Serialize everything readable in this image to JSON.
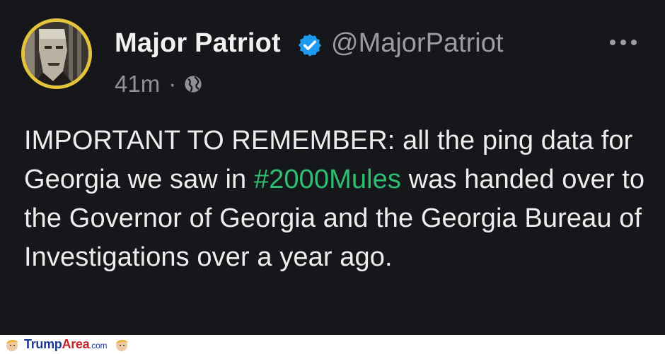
{
  "post": {
    "author_name": "Major Patriot",
    "author_handle": "@MajorPatriot",
    "time_ago": "41m",
    "separator": "·",
    "text_before": "IMPORTANT TO REMEMBER: all the ping data for Georgia we saw in ",
    "hashtag": "#2000Mules",
    "text_after": " was handed over to the Governor of Georgia and the Georgia Bureau of Investigations over a year ago."
  },
  "watermark": {
    "part1": "Trump",
    "part2": "Area",
    "part3": ".com"
  },
  "colors": {
    "background": "#16171b",
    "hashtag": "#2fbf72",
    "verified": "#1d9bf0",
    "avatar_ring": "#e6c33c"
  },
  "icons": [
    "avatar",
    "verified-badge-icon",
    "globe-icon",
    "more-options-icon",
    "trumparea-logo-icon"
  ]
}
